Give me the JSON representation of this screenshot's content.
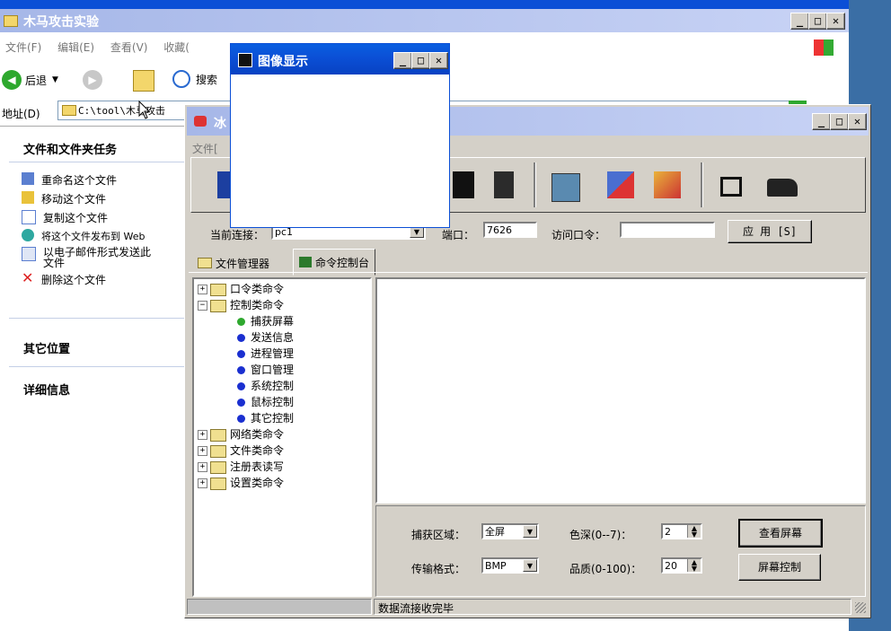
{
  "explorer": {
    "title": "木马攻击实验",
    "menu": [
      "文件(F)",
      "编辑(E)",
      "查看(V)",
      "收藏("
    ],
    "back_label": "后退",
    "search_label": "搜索",
    "address_label": "地址(D)",
    "address_value": "C:\\tool\\木马攻击",
    "tasks_header": "文件和文件夹任务",
    "tasks": [
      "重命名这个文件",
      "移动这个文件",
      "复制这个文件",
      "将这个文件发布到 Web",
      "以电子邮件形式发送此文件",
      "删除这个文件"
    ],
    "other_places": "其它位置",
    "details": "详细信息"
  },
  "image_window": {
    "title": "图像显示"
  },
  "trojan": {
    "title_fragment": "冰",
    "menu_fragment": "文件[",
    "conn_label": "当前连接：",
    "conn_value": "pc1",
    "port_label": "端口：",
    "port_value": "7626",
    "pass_label": "访问口令：",
    "pass_value": "",
    "apply_label": "应 用 [S]",
    "tabs": [
      "文件管理器",
      "命令控制台"
    ],
    "tree": [
      {
        "label": "口令类命令",
        "sign": "+",
        "children": []
      },
      {
        "label": "控制类命令",
        "sign": "−",
        "children": [
          "捕获屏幕",
          "发送信息",
          "进程管理",
          "窗口管理",
          "系统控制",
          "鼠标控制",
          "其它控制"
        ]
      },
      {
        "label": "网络类命令",
        "sign": "+",
        "children": []
      },
      {
        "label": "文件类命令",
        "sign": "+",
        "children": []
      },
      {
        "label": "注册表读写",
        "sign": "+",
        "children": []
      },
      {
        "label": "设置类命令",
        "sign": "+",
        "children": []
      }
    ],
    "capture_area_label": "捕获区域：",
    "capture_area_value": "全屏",
    "transfer_format_label": "传输格式：",
    "transfer_format_value": "BMP",
    "color_depth_label": "色深(0--7)：",
    "color_depth_value": "2",
    "quality_label": "品质(0-100)：",
    "quality_value": "20",
    "view_screen_label": "查看屏幕",
    "screen_control_label": "屏幕控制",
    "status_text": "数据流接收完毕"
  },
  "colors": {
    "desktop": "#3a6ea5",
    "xp_title": "#0b4fd6",
    "panel": "#d4d0c8",
    "green_dot": "#2ea82e",
    "blue_dot": "#1a2fd0"
  }
}
